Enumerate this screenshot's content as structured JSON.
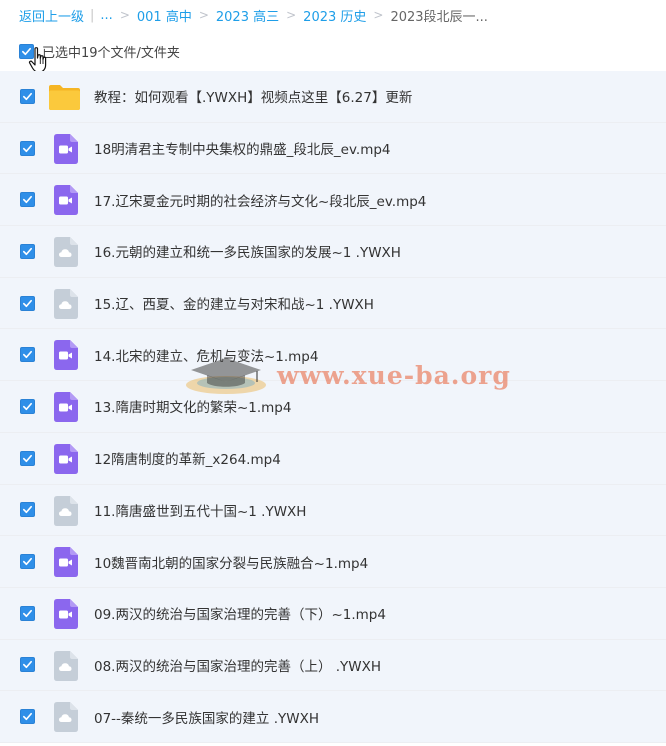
{
  "breadcrumb": {
    "back_label": "返回上一级",
    "ellipsis": "...",
    "items": [
      "001 高中",
      "2023 高三",
      "2023 历史",
      "2023段北辰一..."
    ]
  },
  "selection": {
    "status_text": "已选中19个文件/文件夹"
  },
  "files": [
    {
      "name": "教程：如何观看【.YWXH】视频点这里【6.27】更新",
      "icon": "folder-icon",
      "checked": true
    },
    {
      "name": "18明清君主专制中央集权的鼎盛_段北辰_ev.mp4",
      "icon": "video-icon",
      "checked": true
    },
    {
      "name": "17.辽宋夏金元时期的社会经济与文化~段北辰_ev.mp4",
      "icon": "video-icon",
      "checked": true
    },
    {
      "name": "16.元朝的建立和统一多民族国家的发展~1 .YWXH",
      "icon": "cloud-file-icon",
      "checked": true
    },
    {
      "name": "15.辽、西夏、金的建立与对宋和战~1 .YWXH",
      "icon": "cloud-file-icon",
      "checked": true
    },
    {
      "name": "14.北宋的建立、危机与变法~1.mp4",
      "icon": "video-icon",
      "checked": true
    },
    {
      "name": "13.隋唐时期文化的繁荣~1.mp4",
      "icon": "video-icon",
      "checked": true
    },
    {
      "name": "12隋唐制度的革新_x264.mp4",
      "icon": "video-icon",
      "checked": true
    },
    {
      "name": "11.隋唐盛世到五代十国~1 .YWXH",
      "icon": "cloud-file-icon",
      "checked": true
    },
    {
      "name": "10魏晋南北朝的国家分裂与民族融合~1.mp4",
      "icon": "video-icon",
      "checked": true
    },
    {
      "name": "09.两汉的统治与国家治理的完善（下）~1.mp4",
      "icon": "video-icon",
      "checked": true
    },
    {
      "name": "08.两汉的统治与国家治理的完善（上） .YWXH",
      "icon": "cloud-file-icon",
      "checked": true
    },
    {
      "name": "07--秦统一多民族国家的建立 .YWXH",
      "icon": "cloud-file-icon",
      "checked": true
    }
  ],
  "watermark": {
    "text": "www.xue-ba.org"
  },
  "colors": {
    "link": "#1e9ee8",
    "checkbox": "#2f8fe8",
    "video_icon": "#8b67ee",
    "cloud_icon": "#c5ced8",
    "folder_icon": "#fbc93c",
    "row_bg": "#f1f5fb"
  }
}
